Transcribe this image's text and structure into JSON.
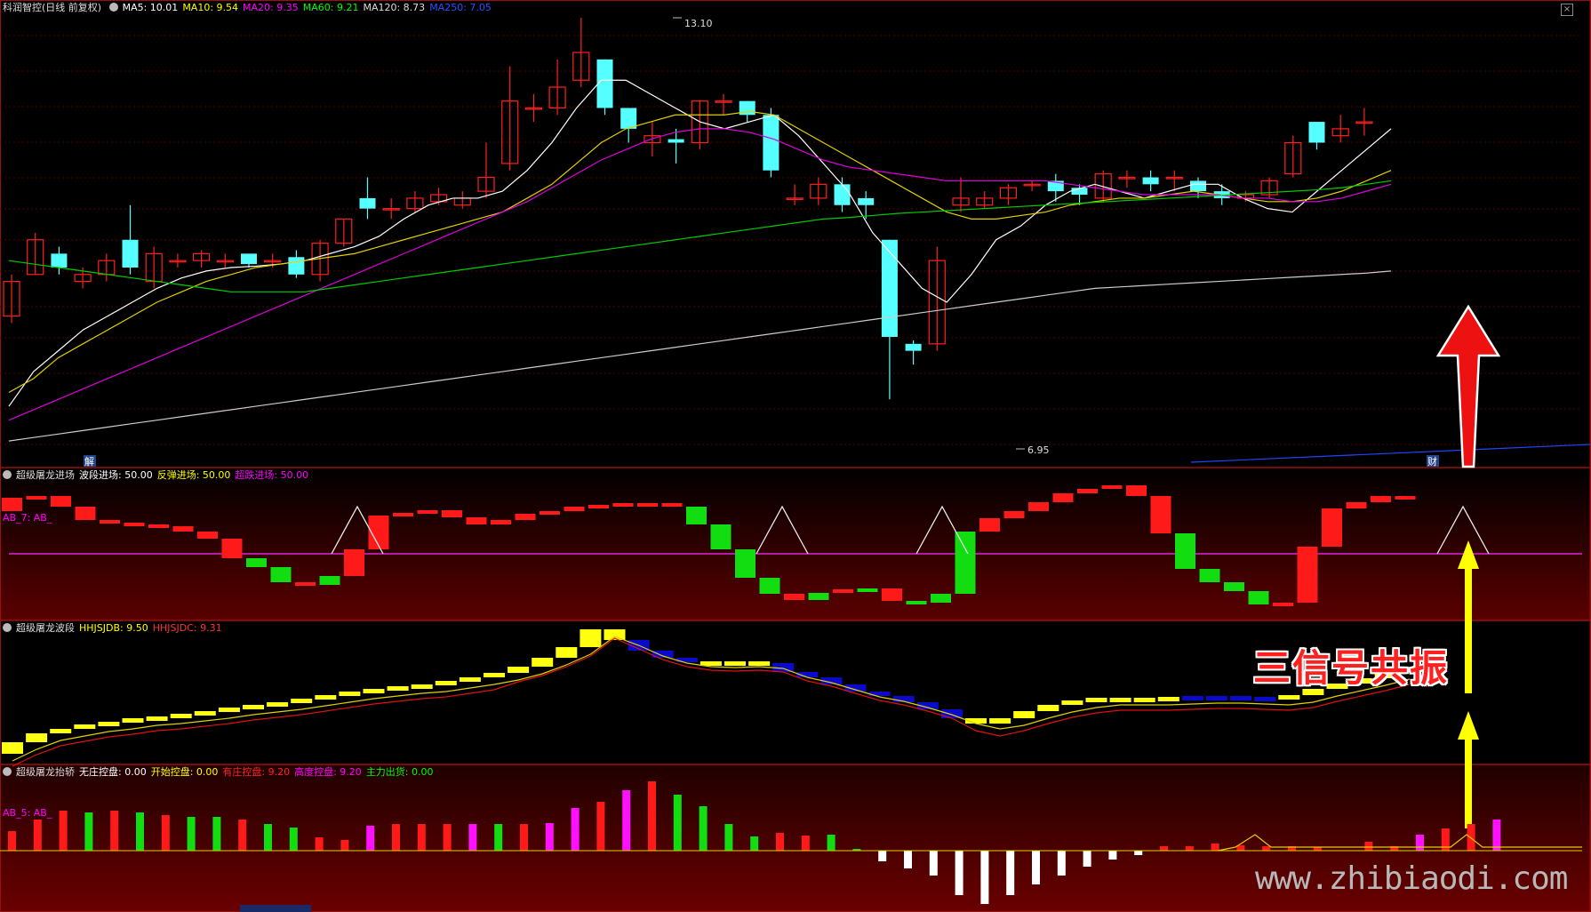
{
  "main": {
    "title": "科润智控(日线 前复权)",
    "ma": [
      {
        "label": "MA5: 10.01",
        "color": "#ffffff"
      },
      {
        "label": "MA10: 9.54",
        "color": "#ffff00"
      },
      {
        "label": "MA20: 9.35",
        "color": "#ff00ff"
      },
      {
        "label": "MA60: 9.21",
        "color": "#00ff00"
      },
      {
        "label": "MA120: 8.73",
        "color": "#dddddd"
      },
      {
        "label": "MA250: 7.05",
        "color": "#2255ff"
      }
    ],
    "high_label": "13.10",
    "low_label": "6.95",
    "marker_left": "解",
    "marker_right": "财"
  },
  "panel1": {
    "title": "超级屠龙进场",
    "items": [
      {
        "label": "波段进场: 50.00",
        "color": "#ffffff"
      },
      {
        "label": "反弹进场: 50.00",
        "color": "#ffff00"
      },
      {
        "label": "超跌进场: 50.00",
        "color": "#ff00ff"
      }
    ],
    "sub": "AB_7: AB_"
  },
  "panel2": {
    "title": "超级屠龙波段",
    "items": [
      {
        "label": "HHJSJDB: 9.50",
        "color": "#ffff00"
      },
      {
        "label": "HHJSJDC: 9.31",
        "color": "#ff3030"
      }
    ]
  },
  "panel3": {
    "title": "超级屠龙抬轿",
    "items": [
      {
        "label": "无庄控盘: 0.00",
        "color": "#ffffff"
      },
      {
        "label": "开始控盘: 0.00",
        "color": "#ffff00"
      },
      {
        "label": "有庄控盘: 9.20",
        "color": "#ff2020"
      },
      {
        "label": "高度控盘: 9.20",
        "color": "#ff00ff"
      },
      {
        "label": "主力出货: 0.00",
        "color": "#00ff00"
      }
    ],
    "sub": "AB_5: AB_"
  },
  "annotation": "三信号共振",
  "watermark": "www.zhibiaodi.com",
  "colors": {
    "up": "#ff2020",
    "down": "#55ffff",
    "accent_yellow": "#ffff00"
  }
}
